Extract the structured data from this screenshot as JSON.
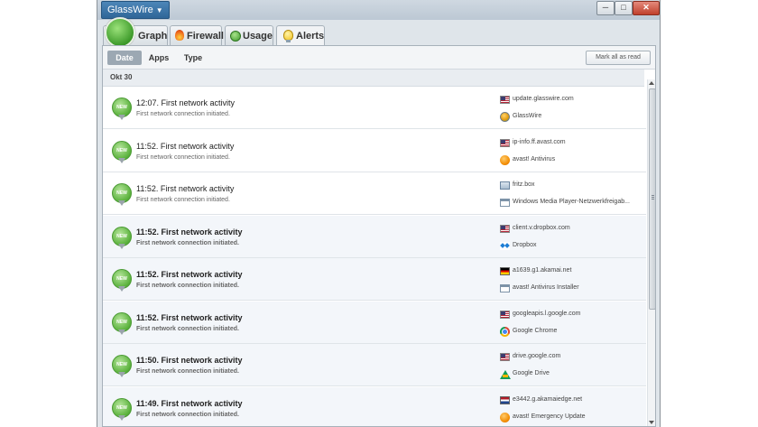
{
  "app": {
    "menu_label": "GlassWire"
  },
  "window_controls": {
    "minimize": "─",
    "maximize": "□",
    "close": "✕"
  },
  "tabs": [
    {
      "label": "Graph",
      "icon": "graph-ball-icon"
    },
    {
      "label": "Firewall",
      "icon": "flame-icon"
    },
    {
      "label": "Usage",
      "icon": "usage-dot-icon"
    },
    {
      "label": "Alerts",
      "icon": "bulb-icon",
      "active": true
    }
  ],
  "filters": {
    "date": "Date",
    "apps": "Apps",
    "type": "Type",
    "selected": "Date"
  },
  "mark_all_label": "Mark all as read",
  "date_header": "Okt 30",
  "badge": "NEW",
  "alerts": [
    {
      "title": "12:07. First network activity",
      "desc": "First network connection initiated.",
      "host": "update.glasswire.com",
      "host_icon": "us-flag-icon",
      "app": "GlassWire",
      "app_icon": "glasswire-icon",
      "unread": false
    },
    {
      "title": "11:52. First network activity",
      "desc": "First network connection initiated.",
      "host": "ip-info.ff.avast.com",
      "host_icon": "us-flag-icon",
      "app": "avast! Antivirus",
      "app_icon": "avast-icon",
      "unread": false
    },
    {
      "title": "11:52. First network activity",
      "desc": "First network connection initiated.",
      "host": "fritz.box",
      "host_icon": "lan-icon",
      "app": "Windows Media Player-Netzwerkfreigab...",
      "app_icon": "window-icon",
      "unread": false
    },
    {
      "title": "11:52. First network activity",
      "desc": "First network connection initiated.",
      "host": "client.v.dropbox.com",
      "host_icon": "us-flag-icon",
      "app": "Dropbox",
      "app_icon": "dropbox-icon",
      "unread": true
    },
    {
      "title": "11:52. First network activity",
      "desc": "First network connection initiated.",
      "host": "a1639.g1.akamai.net",
      "host_icon": "de-flag-icon",
      "app": "avast! Antivirus Installer",
      "app_icon": "window-icon",
      "unread": true
    },
    {
      "title": "11:52. First network activity",
      "desc": "First network connection initiated.",
      "host": "googleapis.l.google.com",
      "host_icon": "us-flag-icon",
      "app": "Google Chrome",
      "app_icon": "chrome-icon",
      "unread": true
    },
    {
      "title": "11:50. First network activity",
      "desc": "First network connection initiated.",
      "host": "drive.google.com",
      "host_icon": "us-flag-icon",
      "app": "Google Drive",
      "app_icon": "gdrive-icon",
      "unread": true
    },
    {
      "title": "11:49. First network activity",
      "desc": "First network connection initiated.",
      "host": "e3442.g.akamaiedge.net",
      "host_icon": "nl-flag-icon",
      "app": "avast! Emergency Update",
      "app_icon": "avast-icon",
      "unread": true
    }
  ]
}
